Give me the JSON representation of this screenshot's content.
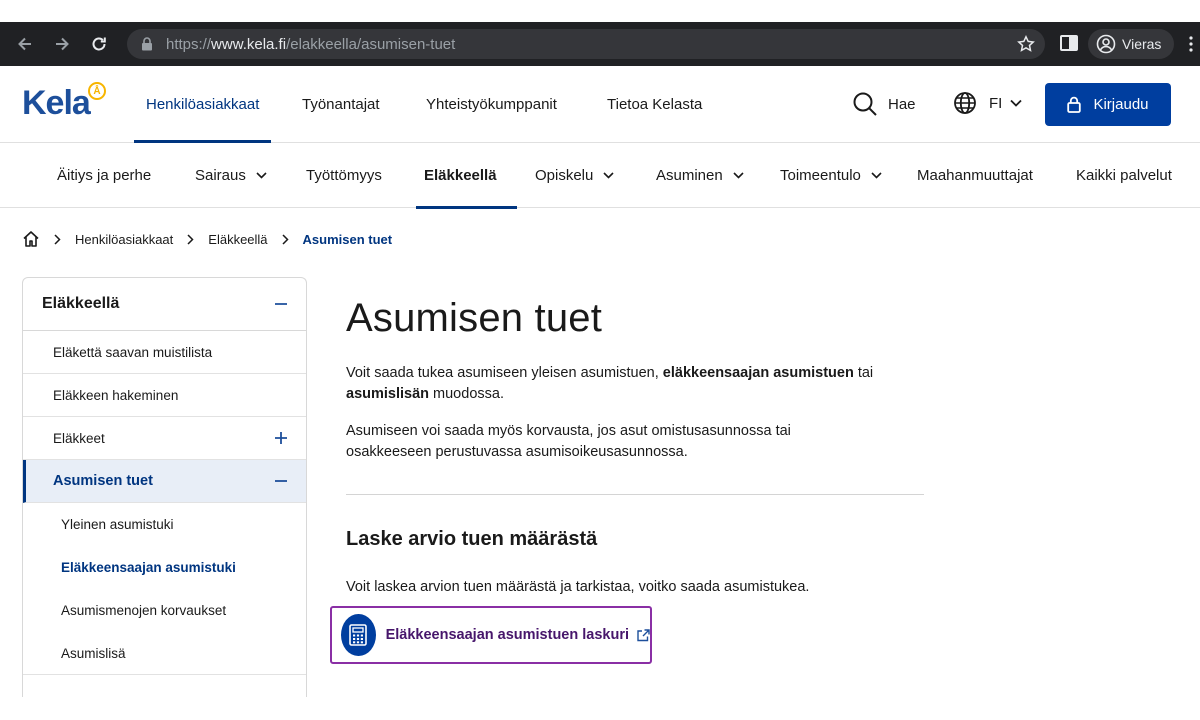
{
  "browser": {
    "url_prefix": "https://",
    "url_host": "www.kela.fi",
    "url_path": "/elakkeella/asumisen-tuet",
    "profile_label": "Vieras"
  },
  "header": {
    "logo_text": "Kela",
    "logo_badge": "Å",
    "nav": [
      "Henkilöasiakkaat",
      "Työnantajat",
      "Yhteistyökumppanit",
      "Tietoa Kelasta"
    ],
    "search_label": "Hae",
    "lang_label": "FI",
    "login_label": "Kirjaudu"
  },
  "categories": {
    "items": [
      "Äitiys ja perhe",
      "Sairaus",
      "Työttömyys",
      "Eläkkeellä",
      "Opiskelu",
      "Asuminen",
      "Toimeentulo",
      "Maahanmuuttajat",
      "Kaikki palvelut"
    ]
  },
  "breadcrumb": {
    "items": [
      "Henkilöasiakkaat",
      "Eläkkeellä",
      "Asumisen tuet"
    ]
  },
  "sidenav": {
    "title": "Eläkkeellä",
    "items": [
      "Eläkettä saavan muistilista",
      "Eläkkeen hakeminen",
      "Eläkkeet",
      "Asumisen tuet"
    ],
    "sub_items": [
      "Yleinen asumistuki",
      "Eläkkeensaajan asumistuki",
      "Asumismenojen korvaukset",
      "Asumislisä"
    ]
  },
  "main": {
    "title": "Asumisen tuet",
    "intro_part1": "Voit saada tukea asumiseen yleisen asumistuen, ",
    "intro_bold1": "eläkkeensaajan asumistuen",
    "intro_part2": " tai ",
    "intro_bold2": "asumislisän",
    "intro_part3": " muodossa.",
    "para2": "Asumiseen voi saada myös korvausta, jos asut omistusasunnossa tai osakkeeseen perustuvassa asumisoikeusasunnossa.",
    "section_title": "Laske arvio tuen määrästä",
    "section_text": "Voit laskea arvion tuen määrästä ja tarkistaa, voitko saada asumistukea.",
    "calc_link": "Eläkkeensaajan asumistuen laskuri"
  },
  "colors": {
    "brand_blue": "#003e9f",
    "link_purple": "#8a2fa5",
    "logo_yellow": "#f7b500"
  }
}
